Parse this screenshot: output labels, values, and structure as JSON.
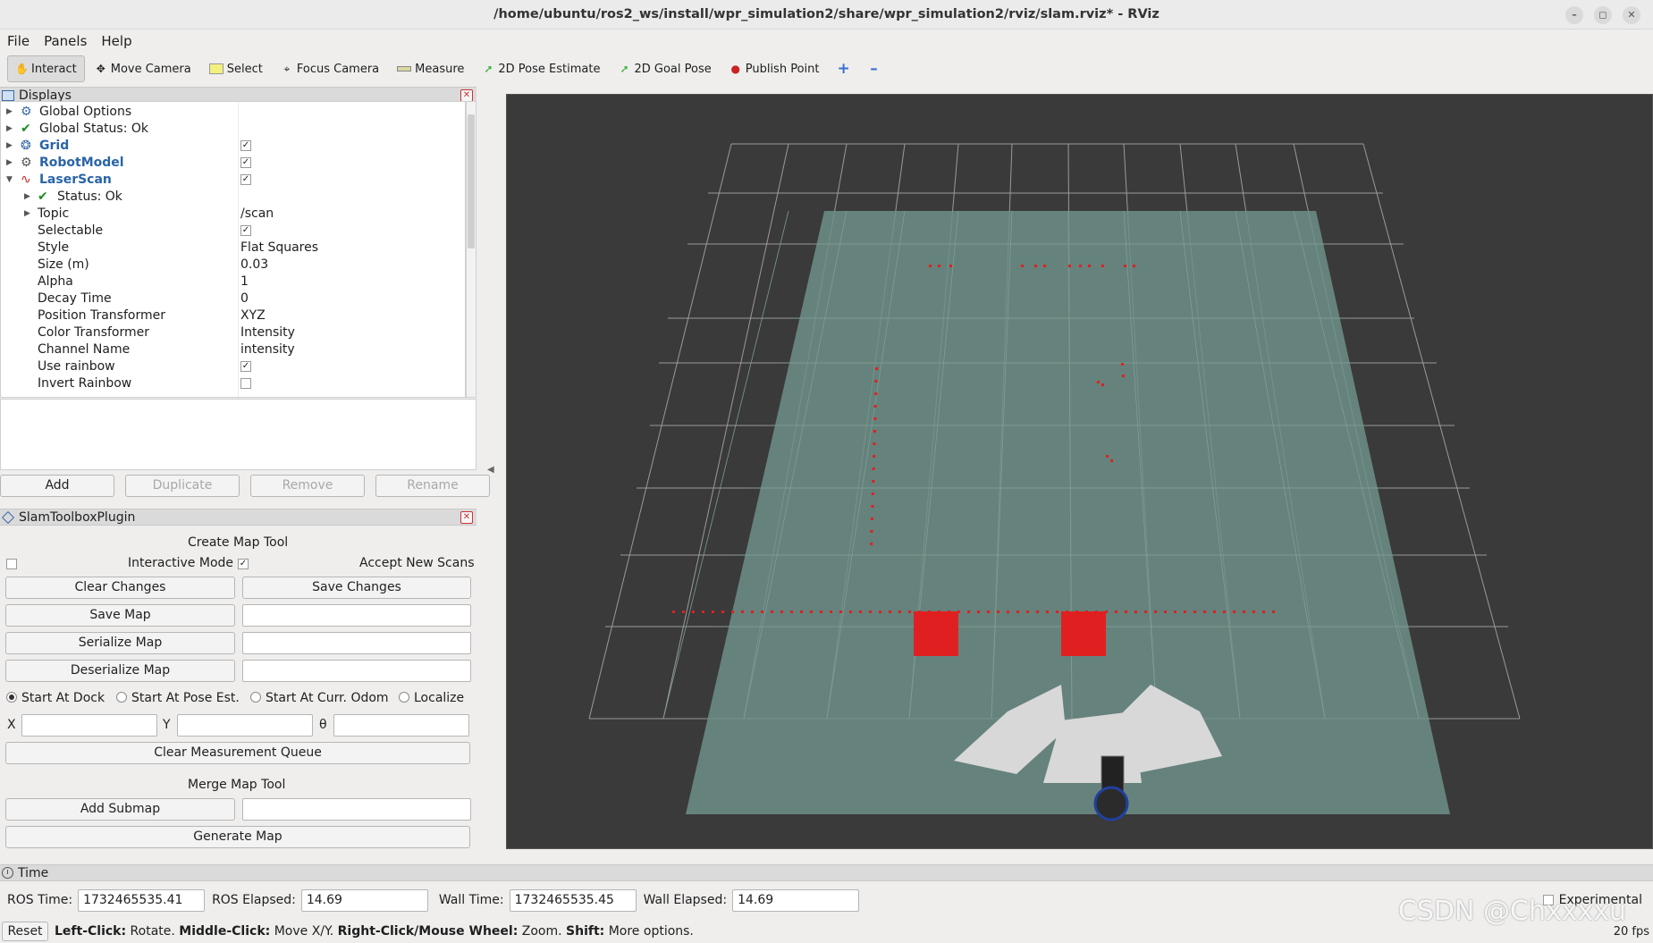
{
  "window": {
    "title": "/home/ubuntu/ros2_ws/install/wpr_simulation2/share/wpr_simulation2/rviz/slam.rviz* - RViz"
  },
  "menu": [
    "File",
    "Panels",
    "Help"
  ],
  "toolbar": {
    "interact": "Interact",
    "move_camera": "Move Camera",
    "select": "Select",
    "focus_camera": "Focus Camera",
    "measure": "Measure",
    "pose_estimate": "2D Pose Estimate",
    "goal_pose": "2D Goal Pose",
    "publish_point": "Publish Point"
  },
  "displays": {
    "title": "Displays",
    "global_options": "Global Options",
    "global_status": "Global Status: Ok",
    "grid": "Grid",
    "robot_model": "RobotModel",
    "laser_scan": "LaserScan",
    "status": "Status: Ok",
    "props": [
      {
        "name": "Topic",
        "value": "/scan"
      },
      {
        "name": "Selectable",
        "value": "✓"
      },
      {
        "name": "Style",
        "value": "Flat Squares"
      },
      {
        "name": "Size (m)",
        "value": "0.03"
      },
      {
        "name": "Alpha",
        "value": "1"
      },
      {
        "name": "Decay Time",
        "value": "0"
      },
      {
        "name": "Position Transformer",
        "value": "XYZ"
      },
      {
        "name": "Color Transformer",
        "value": "Intensity"
      },
      {
        "name": "Channel Name",
        "value": "intensity"
      },
      {
        "name": "Use rainbow",
        "value": "✓"
      },
      {
        "name": "Invert Rainbow",
        "value": ""
      }
    ],
    "buttons": {
      "add": "Add",
      "duplicate": "Duplicate",
      "remove": "Remove",
      "rename": "Rename"
    }
  },
  "slam": {
    "title": "SlamToolboxPlugin",
    "create_map_tool": "Create Map Tool",
    "interactive_mode": "Interactive Mode",
    "accept_new_scans": "Accept New Scans",
    "clear_changes": "Clear Changes",
    "save_changes": "Save Changes",
    "save_map": "Save Map",
    "serialize_map": "Serialize Map",
    "deserialize_map": "Deserialize Map",
    "start_at_dock": "Start At Dock",
    "start_at_pose": "Start At Pose Est.",
    "start_at_odom": "Start At Curr. Odom",
    "localize": "Localize",
    "x": "X",
    "y": "Y",
    "theta": "θ",
    "clear_queue": "Clear Measurement Queue",
    "merge_map_tool": "Merge Map Tool",
    "add_submap": "Add Submap",
    "generate_map": "Generate Map"
  },
  "time": {
    "title": "Time",
    "ros_time_label": "ROS Time:",
    "ros_time": "1732465535.41",
    "ros_elapsed_label": "ROS Elapsed:",
    "ros_elapsed": "14.69",
    "wall_time_label": "Wall Time:",
    "wall_time": "1732465535.45",
    "wall_elapsed_label": "Wall Elapsed:",
    "wall_elapsed": "14.69",
    "experimental": "Experimental"
  },
  "status": {
    "reset": "Reset",
    "left_click": "Left-Click:",
    "left_click_desc": " Rotate. ",
    "middle_click": "Middle-Click:",
    "middle_click_desc": " Move X/Y. ",
    "right_click": "Right-Click/Mouse Wheel:",
    "right_click_desc": " Zoom. ",
    "shift": "Shift:",
    "shift_desc": " More options.",
    "fps": "20 fps"
  },
  "watermark": "CSDN @Chxxxxu",
  "colors": {
    "scan": "#e02020",
    "map_free": "#6e8f88",
    "grid": "#9a9a9a",
    "background": "#3a3a3a"
  }
}
